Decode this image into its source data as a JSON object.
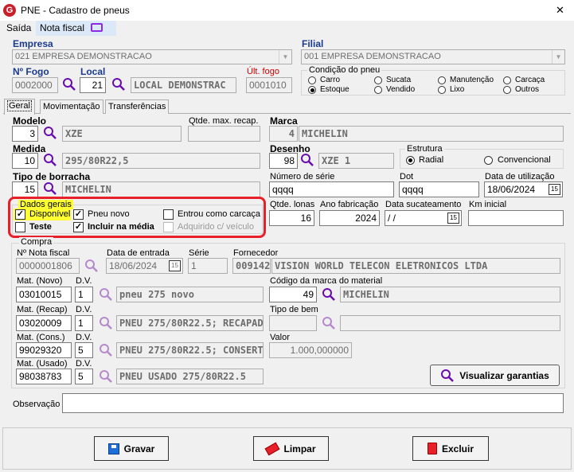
{
  "window": {
    "title": "PNE - Cadastro de pneus",
    "close": "✕"
  },
  "menu": {
    "saida": "Saída",
    "nota_fiscal": "Nota fiscal"
  },
  "empresa": {
    "label": "Empresa",
    "value": "021 EMPRESA DEMONSTRACAO"
  },
  "filial": {
    "label": "Filial",
    "value": "001 EMPRESA DEMONSTRACAO"
  },
  "fogo": {
    "label": "Nº Fogo",
    "value": "0002000"
  },
  "local": {
    "label": "Local",
    "code": "21",
    "name": "LOCAL DEMONSTRAC"
  },
  "ult_fogo": {
    "label": "Últ. fogo",
    "value": "0001010"
  },
  "condicao": {
    "title": "Condição do pneu",
    "options": [
      "Carro",
      "Sucata",
      "Manutenção",
      "Carcaça",
      "Estoque",
      "Vendido",
      "Lixo",
      "Outros"
    ],
    "selected": "Estoque"
  },
  "tabs": [
    "Geral",
    "Movimentação",
    "Transferências"
  ],
  "modelo": {
    "label": "Modelo",
    "code": "3",
    "name": "XZE"
  },
  "qtde_max": {
    "label": "Qtde. max. recap.",
    "value": ""
  },
  "marca": {
    "label": "Marca",
    "code": "4",
    "name": "MICHELIN"
  },
  "medida": {
    "label": "Medida",
    "code": "10",
    "name": "295/80R22,5"
  },
  "desenho": {
    "label": "Desenho",
    "code": "98",
    "name": "XZE 1"
  },
  "estrutura": {
    "title": "Estrutura",
    "options": [
      "Radial",
      "Convencional"
    ],
    "selected": "Radial"
  },
  "tipo_borracha": {
    "label": "Tipo de borracha",
    "code": "15",
    "name": "MICHELIN"
  },
  "numero_serie": {
    "label": "Número de série",
    "value": "qqqq"
  },
  "dot": {
    "label": "Dot",
    "value": "qqqq"
  },
  "data_utilizacao": {
    "label": "Data de utilização",
    "value": "18/06/2024"
  },
  "dados_gerais": {
    "title": "Dados gerais",
    "disponivel": "Disponível",
    "pneu_novo": "Pneu novo",
    "entrou": "Entrou como carcaça",
    "teste": "Teste",
    "incluir": "Incluir na média",
    "adquirido": "Adquirido c/ veículo",
    "highlight": "#ffff33",
    "ring": "#e8202a"
  },
  "qtde_lonas": {
    "label": "Qtde. lonas",
    "value": "16"
  },
  "ano_fabricacao": {
    "label": "Ano fabricação",
    "value": "2024"
  },
  "data_sucateamento": {
    "label": "Data sucateamento",
    "value": " / /"
  },
  "km_inicial": {
    "label": "Km inicial",
    "value": ""
  },
  "compra": {
    "title": "Compra",
    "nf_label": "Nº Nota fiscal",
    "nf_value": "0000001806",
    "data_label": "Data de entrada",
    "data_value": "18/06/2024",
    "serie_label": "Série",
    "serie_value": "1",
    "fornecedor_label": "Fornecedor",
    "fornecedor_code": "009142",
    "fornecedor_name": "VISION WORLD TELECON ELETRONICOS LTDA"
  },
  "mat_novo": {
    "label": "Mat. (Novo)",
    "dv_label": "D.V.",
    "code": "03010015",
    "dv": "1",
    "name": "pneu 275 novo"
  },
  "cod_marca_material": {
    "label": "Código da marca do material",
    "code": "49",
    "name": "MICHELIN"
  },
  "mat_recap": {
    "label": "Mat. (Recap)",
    "dv_label": "D.V.",
    "code": "03020009",
    "dv": "1",
    "name": "PNEU 275/80R22.5; RECAPAD"
  },
  "tipo_bem": {
    "label": "Tipo de bem"
  },
  "mat_cons": {
    "label": "Mat. (Cons.)",
    "dv_label": "D.V.",
    "code": "99029320",
    "dv": "5",
    "name": "PNEU 275/80R22.5; CONSERT"
  },
  "valor": {
    "label": "Valor",
    "value": "1.000,000000"
  },
  "mat_usado": {
    "label": "Mat. (Usado)",
    "dv_label": "D.V.",
    "code": "98038783",
    "dv": "5",
    "name": "PNEU USADO 275/80R22.5"
  },
  "visualizar": "Visualizar garantias",
  "observacao": {
    "label": "Observação"
  },
  "buttons": {
    "gravar": "Gravar",
    "limpar": "Limpar",
    "excluir": "Excluir"
  }
}
